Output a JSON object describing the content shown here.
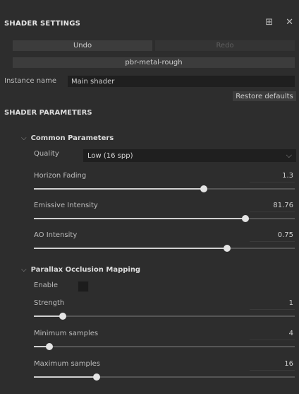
{
  "header": {
    "title": "SHADER SETTINGS",
    "icons": [
      "panel-icon",
      "close-icon"
    ]
  },
  "actions": {
    "undo": "Undo",
    "redo": "Redo"
  },
  "shader": {
    "name_label": "pbr-metal-rough"
  },
  "instance": {
    "label": "Instance name",
    "value": "Main shader"
  },
  "restore_defaults": "Restore defaults",
  "section": {
    "title": "SHADER PARAMETERS"
  },
  "groups": {
    "common": {
      "title": "Common Parameters",
      "quality": {
        "label": "Quality",
        "value": "Low (16 spp)"
      },
      "sliders": [
        {
          "label": "Horizon Fading",
          "value": "1.3",
          "fraction": 0.65
        },
        {
          "label": "Emissive Intensity",
          "value": "81.76",
          "fraction": 0.81
        },
        {
          "label": "AO Intensity",
          "value": "0.75",
          "fraction": 0.74
        }
      ]
    },
    "pom": {
      "title": "Parallax Occlusion Mapping",
      "enable": {
        "label": "Enable",
        "checked": false
      },
      "sliders": [
        {
          "label": "Strength",
          "value": "1",
          "fraction": 0.11
        },
        {
          "label": "Minimum samples",
          "value": "4",
          "fraction": 0.06
        },
        {
          "label": "Maximum samples",
          "value": "16",
          "fraction": 0.24
        }
      ]
    }
  }
}
